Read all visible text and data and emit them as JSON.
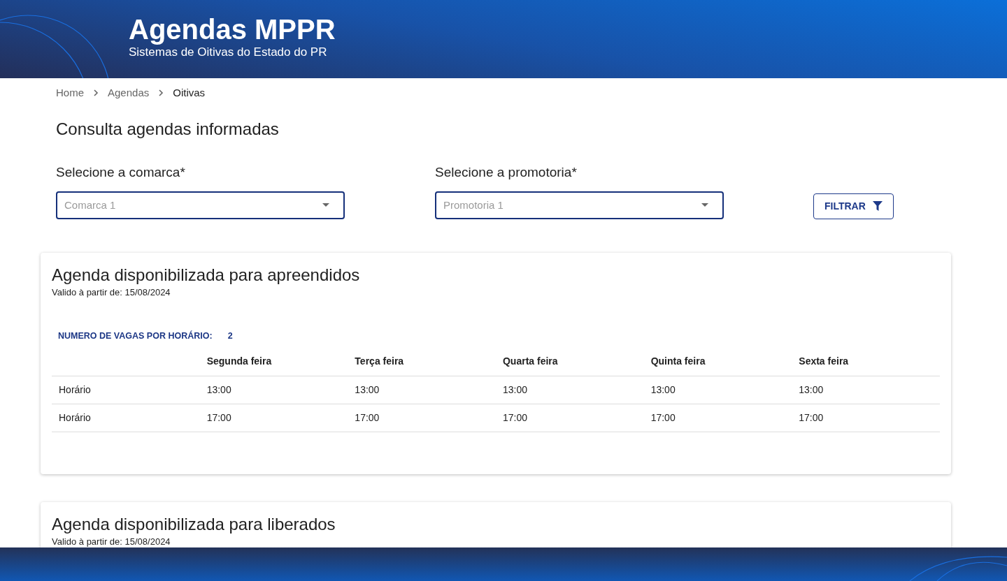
{
  "header": {
    "title": "Agendas MPPR",
    "subtitle": "Sistemas de Oitivas do Estado do PR"
  },
  "breadcrumb": [
    {
      "label": "Home",
      "current": false
    },
    {
      "label": "Agendas",
      "current": false
    },
    {
      "label": "Oitivas",
      "current": true
    }
  ],
  "page_title": "Consulta agendas informadas",
  "filters": [
    {
      "label": "Selecione a comarca*",
      "placeholder": "Comarca 1"
    },
    {
      "label": "Selecione a promotoria*",
      "placeholder": "Promotoria 1"
    }
  ],
  "filter_button": "FILTRAR",
  "agendas": [
    {
      "title": "Agenda disponibilizada para apreendidos",
      "valid_from": "Valido à partir de: 15/08/2024",
      "slots_label": "NUMERO DE VAGAS POR HORÁRIO:",
      "slots_value": "2",
      "columns": [
        "",
        "Segunda feira",
        "Terça feira",
        "Quarta feira",
        "Quinta feira",
        "Sexta feira"
      ],
      "rows": [
        [
          "Horário",
          "13:00",
          "13:00",
          "13:00",
          "13:00",
          "13:00"
        ],
        [
          "Horário",
          "17:00",
          "17:00",
          "17:00",
          "17:00",
          "17:00"
        ]
      ]
    },
    {
      "title": "Agenda disponibilizada para liberados",
      "valid_from": "Valido à partir de: 15/08/2024"
    }
  ]
}
